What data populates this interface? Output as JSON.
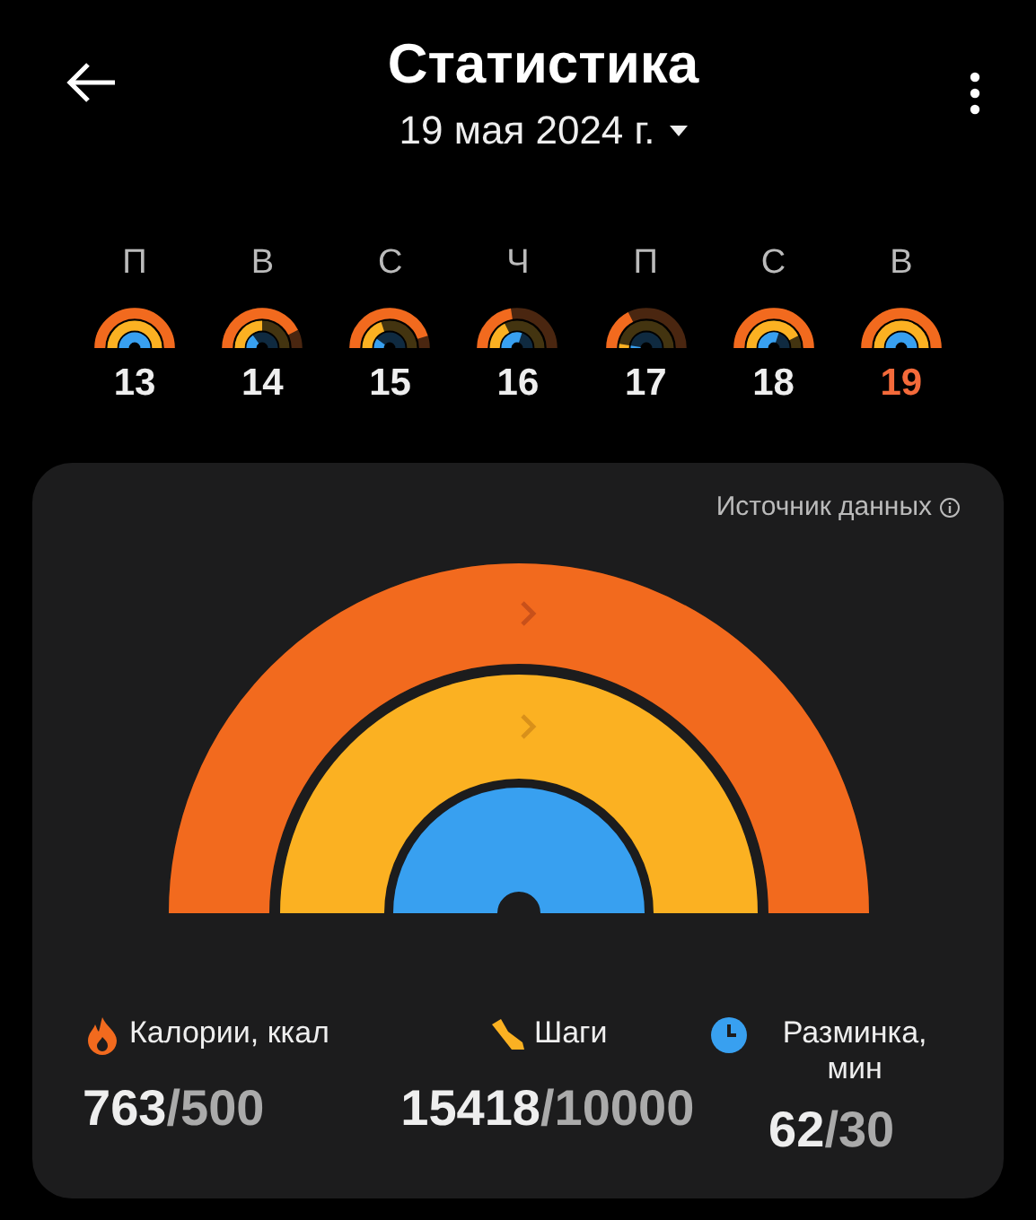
{
  "header": {
    "title": "Статистика",
    "date": "19 мая 2024 г."
  },
  "week": [
    {
      "weekday": "П",
      "day": "13",
      "selected": false
    },
    {
      "weekday": "В",
      "day": "14",
      "selected": false
    },
    {
      "weekday": "С",
      "day": "15",
      "selected": false
    },
    {
      "weekday": "Ч",
      "day": "16",
      "selected": false
    },
    {
      "weekday": "П",
      "day": "17",
      "selected": false
    },
    {
      "weekday": "С",
      "day": "18",
      "selected": false
    },
    {
      "weekday": "В",
      "day": "19",
      "selected": true
    }
  ],
  "source": "Источник данных",
  "rings": [
    {
      "color": "#f26a1e"
    },
    {
      "color": "#fbb122"
    },
    {
      "color": "#38a0f0"
    }
  ],
  "metrics": [
    {
      "kind": "calories",
      "label": "Калории, ккал",
      "value": "763",
      "goal": "/500"
    },
    {
      "kind": "steps",
      "label": "Шаги",
      "value": "15418",
      "goal": "/10000"
    },
    {
      "kind": "minutes",
      "label": "Разминка, мин",
      "value": "62",
      "goal": "/30"
    }
  ]
}
